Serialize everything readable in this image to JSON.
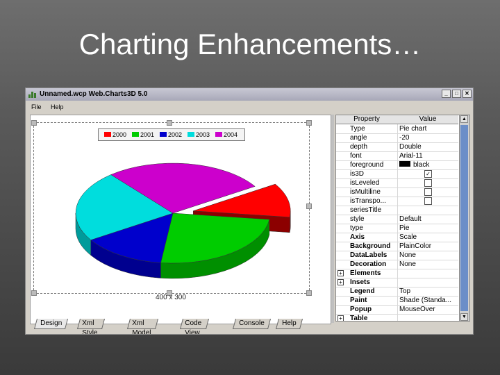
{
  "slide": {
    "title": "Charting Enhancements…"
  },
  "window": {
    "title": "Unnamed.wcp   Web.Charts3D 5.0",
    "buttons": {
      "minimize": "_",
      "maximize": "□",
      "close": "✕"
    }
  },
  "menu": {
    "file": "File",
    "help": "Help"
  },
  "canvas": {
    "size_label": "400 x 300"
  },
  "chart_data": {
    "type": "pie",
    "categories": [
      "2000",
      "2001",
      "2002",
      "2003",
      "2004"
    ],
    "values": [
      11,
      25,
      14,
      23,
      27
    ],
    "colors": [
      "#ff0000",
      "#00cc00",
      "#0000cc",
      "#00dddd",
      "#cc00cc"
    ],
    "exploded": "2000",
    "title": "",
    "legend_position": "top"
  },
  "properties": {
    "header": {
      "property": "Property",
      "value": "Value"
    },
    "rows": [
      {
        "name": "Type",
        "value": "Pie chart",
        "bold": false
      },
      {
        "name": "angle",
        "value": "-20",
        "bold": false
      },
      {
        "name": "depth",
        "value": "Double",
        "bold": false
      },
      {
        "name": "font",
        "value": "Arial-11",
        "bold": false
      },
      {
        "name": "foreground",
        "value": "black",
        "bold": false,
        "swatch": true
      },
      {
        "name": "is3D",
        "value": "",
        "bold": false,
        "checkbox": "checked"
      },
      {
        "name": "isLeveled",
        "value": "",
        "bold": false,
        "checkbox": "unchecked"
      },
      {
        "name": "isMultiline",
        "value": "",
        "bold": false,
        "checkbox": "unchecked"
      },
      {
        "name": "isTranspo...",
        "value": "",
        "bold": false,
        "checkbox": "unchecked"
      },
      {
        "name": "seriesTitle",
        "value": "",
        "bold": false
      },
      {
        "name": "style",
        "value": "Default",
        "bold": false
      },
      {
        "name": "type",
        "value": "Pie",
        "bold": false
      },
      {
        "name": "Axis",
        "value": "Scale",
        "bold": true
      },
      {
        "name": "Background",
        "value": "PlainColor",
        "bold": true
      },
      {
        "name": "DataLabels",
        "value": "None",
        "bold": true
      },
      {
        "name": "Decoration",
        "value": "None",
        "bold": true
      },
      {
        "name": "Elements",
        "value": "",
        "bold": true,
        "expander": "+"
      },
      {
        "name": "Insets",
        "value": "",
        "bold": true,
        "expander": "+"
      },
      {
        "name": "Legend",
        "value": "Top",
        "bold": true
      },
      {
        "name": "Paint",
        "value": "Shade (Standa...",
        "bold": true
      },
      {
        "name": "Popup",
        "value": "MouseOver",
        "bold": true
      },
      {
        "name": "Table",
        "value": "",
        "bold": true,
        "expander": "+"
      }
    ]
  },
  "tabs": [
    {
      "label": "Design",
      "active": true
    },
    {
      "label": "Xml Style",
      "active": false
    },
    {
      "label": "Xml Model",
      "active": false
    },
    {
      "label": "Code View",
      "active": false
    },
    {
      "label": "Console",
      "active": false
    },
    {
      "label": "Help",
      "active": false
    }
  ]
}
